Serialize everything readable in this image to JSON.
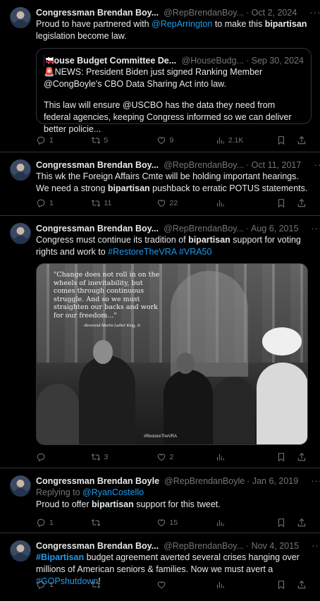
{
  "tweets": [
    {
      "name": "Congressman Brendan Boy...",
      "handle": "@RepBrendanBoy...",
      "date": "· Oct 2, 2024",
      "text_parts": [
        "Proud to have partnered with ",
        "@RepArrington",
        " to make this ",
        "bipartisan",
        " legislation become law."
      ],
      "quote": {
        "name": "House Budget Committee De...",
        "handle": "@HouseBudg...",
        "date": "· Sep 30, 2024",
        "line1": "🚨NEWS: President Biden just signed Ranking Member @CongBoyle's CBO Data Sharing Act into law.",
        "line2": "This law will ensure @USCBO has the data they need from federal agencies, keeping Congress informed so we can deliver better policie..."
      },
      "replies": "1",
      "retweets": "5",
      "likes": "9",
      "views": "2.1K"
    },
    {
      "name": "Congressman Brendan Boy...",
      "handle": "@RepBrendanBoy...",
      "date": "· Oct 11, 2017",
      "text_parts": [
        "This wk the Foreign Affairs Cmte will be holding important hearings. We need a strong ",
        "bipartisan",
        " pushback to erratic POTUS statements."
      ],
      "replies": "1",
      "retweets": "11",
      "likes": "22",
      "views": ""
    },
    {
      "name": "Congressman Brendan Boy...",
      "handle": "@RepBrendanBoy...",
      "date": "· Aug 6, 2015",
      "text_parts": [
        "Congress must continue its tradition of ",
        "bipartisan",
        " support for voting rights and work to ",
        "#RestoreTheVRA",
        " ",
        "#VRA50"
      ],
      "image": {
        "quote": "\"Change does not roll in on the wheels of inevitability, but comes through continuous struggle. And so we must straighten our backs and work for our freedom...\"",
        "attribution": "-Reverend Martin Luther King, Jr.",
        "hashtag": "#RestoreTheVRA"
      },
      "replies": "",
      "retweets": "3",
      "likes": "2",
      "views": ""
    },
    {
      "name": "Congressman Brendan Boyle",
      "handle": "@RepBrendanBoyle",
      "date": "· Jan 6, 2019",
      "replying_label": "Replying to ",
      "replying_to": "@RyanCostello",
      "text_parts": [
        "Proud to offer ",
        "bipartisan",
        " support for this tweet."
      ],
      "replies": "1",
      "retweets": "",
      "likes": "15",
      "views": ""
    },
    {
      "name": "Congressman Brendan Boy...",
      "handle": "@RepBrendanBoy...",
      "date": "· Nov 4, 2015",
      "text_parts": [
        "#Bipartisan",
        " budget agreement averted several crises hanging over millions of American seniors & families. Now we must avert a ",
        "#GOPshutdown",
        "!"
      ],
      "replies": "1",
      "retweets": "",
      "likes": "",
      "views": ""
    }
  ],
  "colors": {
    "background": "#000000",
    "text": "#e7e9ea",
    "muted": "#71767b",
    "link": "#1d9bf0",
    "verified": "#829aab",
    "divider": "#2f3336"
  },
  "icons": [
    "verified-badge-icon",
    "grok-icon",
    "more-icon",
    "reply-icon",
    "retweet-icon",
    "like-icon",
    "views-icon",
    "bookmark-icon",
    "share-icon"
  ]
}
